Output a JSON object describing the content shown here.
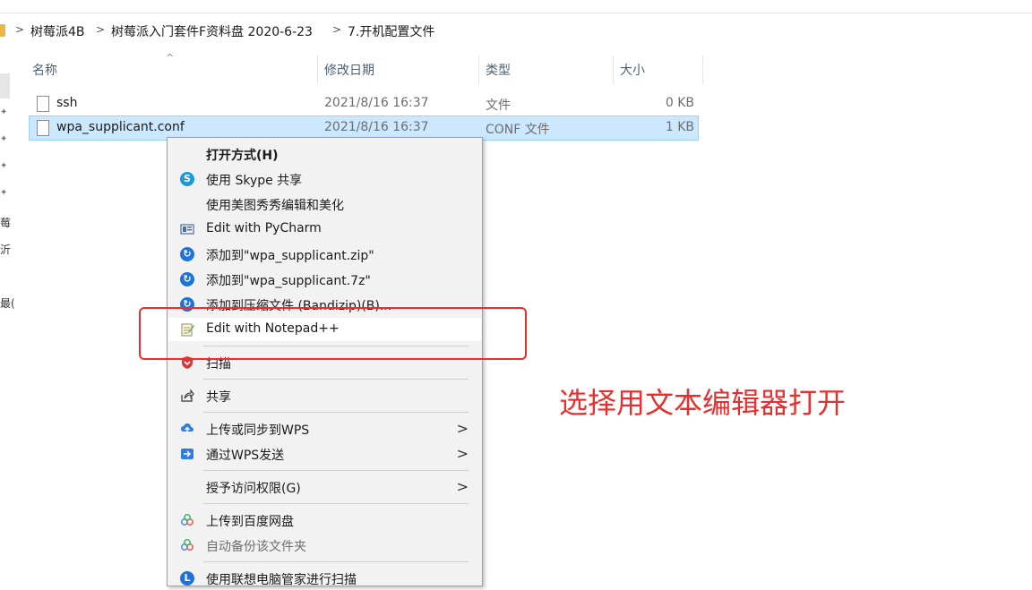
{
  "breadcrumb": {
    "items": [
      "树莓派4B",
      "树莓派入门套件F资料盘 2020-6-23",
      "7.开机配置文件"
    ],
    "separator": ">"
  },
  "nav": {
    "fragments": [
      "莓",
      "沂",
      "最("
    ]
  },
  "columns": {
    "name": "名称",
    "date": "修改日期",
    "type": "类型",
    "size": "大小"
  },
  "files": [
    {
      "name": "ssh",
      "date": "2021/8/16 16:37",
      "type": "文件",
      "size": "0 KB",
      "selected": false
    },
    {
      "name": "wpa_supplicant.conf",
      "date": "2021/8/16 16:37",
      "type": "CONF 文件",
      "size": "1 KB",
      "selected": true
    }
  ],
  "context_menu": {
    "items": [
      {
        "label": "打开方式(H)",
        "icon": "none",
        "bold": true
      },
      {
        "label": "使用 Skype 共享",
        "icon": "skype-icon"
      },
      {
        "label": "使用美图秀秀编辑和美化",
        "icon": "none"
      },
      {
        "label": "Edit with PyCharm",
        "icon": "pycharm-icon"
      },
      {
        "label": "添加到\"wpa_supplicant.zip\"",
        "icon": "bandizip-icon"
      },
      {
        "label": "添加到\"wpa_supplicant.7z\"",
        "icon": "bandizip-icon"
      },
      {
        "label": "添加到压缩文件 (Bandizip)(B)...",
        "icon": "bandizip-icon"
      },
      {
        "label": "Edit with Notepad++",
        "icon": "notepad-icon"
      },
      {
        "label": "扫描",
        "icon": "shield-icon"
      },
      {
        "label": "共享",
        "icon": "share-icon"
      },
      {
        "label": "上传或同步到WPS",
        "icon": "wps-upload-icon",
        "submenu": true
      },
      {
        "label": "通过WPS发送",
        "icon": "wps-send-icon",
        "submenu": true
      },
      {
        "label": "授予访问权限(G)",
        "icon": "none",
        "submenu": true
      },
      {
        "label": "上传到百度网盘",
        "icon": "baidu-icon"
      },
      {
        "label": "自动备份该文件夹",
        "icon": "baidu-icon",
        "gray": true
      },
      {
        "label": "使用联想电脑管家进行扫描",
        "icon": "lenovo-icon"
      }
    ]
  },
  "annotation": {
    "text": "选择用文本编辑器打开",
    "color": "#e53030"
  },
  "colors": {
    "selection": "#cce8ff",
    "menu_bg": "#f2f2f2",
    "accent_red": "#e53030"
  }
}
